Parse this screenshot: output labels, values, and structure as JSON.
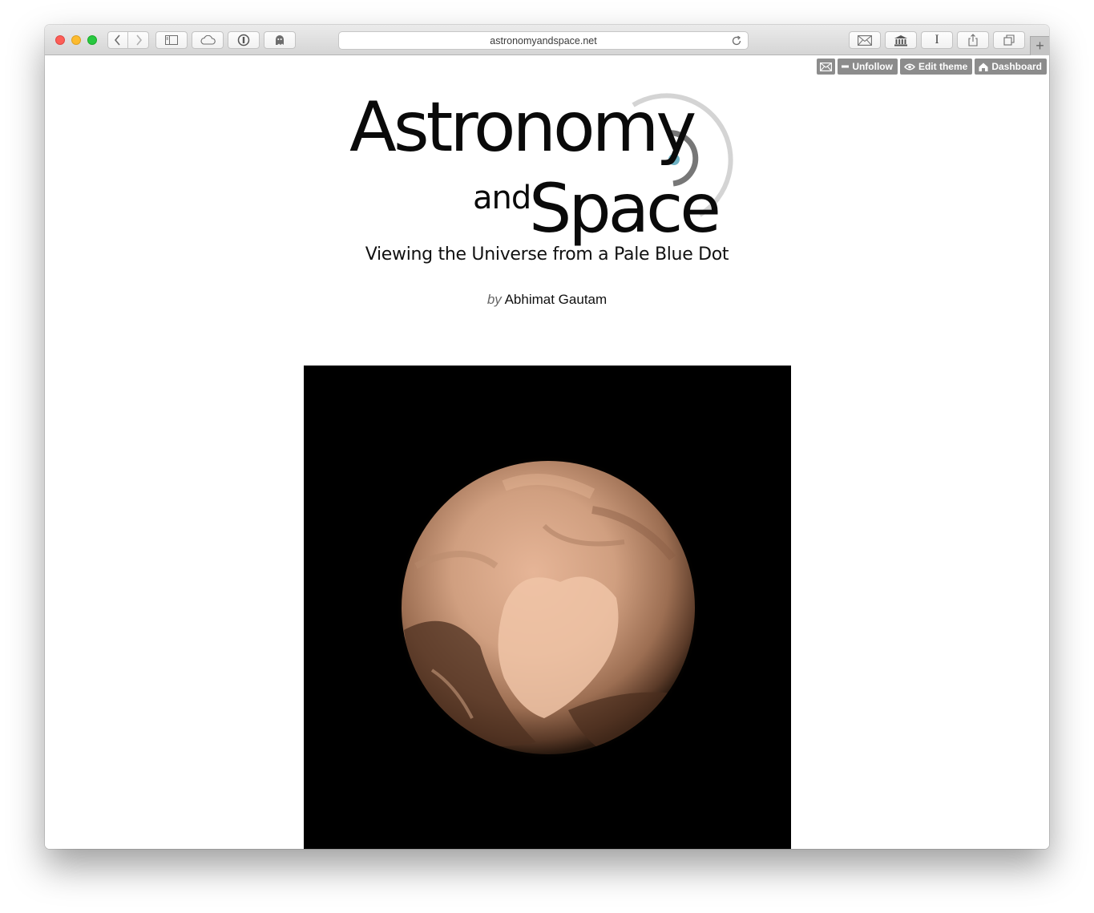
{
  "browser": {
    "address": "astronomyandspace.net",
    "new_tab": "+"
  },
  "blog_controls": {
    "unfollow": "Unfollow",
    "edit_theme": "Edit theme",
    "dashboard": "Dashboard"
  },
  "header": {
    "logo_line1": "Astronomy",
    "logo_line2a": "and",
    "logo_line2b": "Space",
    "tagline": "Viewing the Universe from a Pale Blue Dot",
    "byline_prefix": "by",
    "byline_name": "Abhimat Gautam"
  },
  "colors": {
    "accent_dot": "#6fb3c5",
    "controls_bg": "#8c8c8c"
  }
}
